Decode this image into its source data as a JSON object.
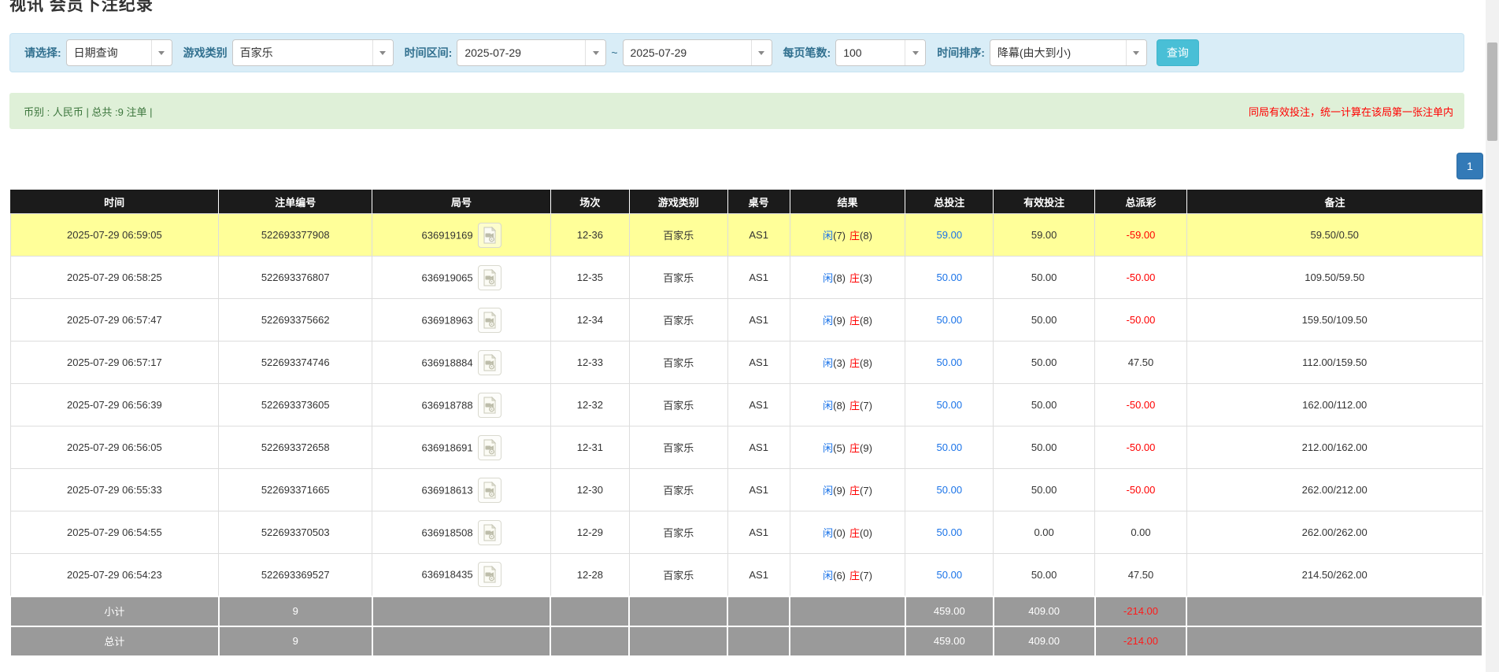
{
  "page": {
    "title": "视讯 会员下注纪录"
  },
  "filter": {
    "select_label": "请选择:",
    "select_value": "日期查询",
    "game_label": "游戏类别",
    "game_value": "百家乐",
    "range_label": "时间区间:",
    "date_from": "2025-07-29",
    "range_sep": "~",
    "date_to": "2025-07-29",
    "per_page_label": "每页笔数:",
    "per_page_value": "100",
    "sort_label": "时间排序:",
    "sort_value": "降幕(由大到小)",
    "search_button": "查询"
  },
  "summary": {
    "left_text": "币别 : 人民币 | 总共 :9 注单 |",
    "right_text": "同局有效投注，统一计算在该局第一张注单内"
  },
  "pagination": {
    "page": "1"
  },
  "icons": {
    "video_icon": "video-replay-icon",
    "dropdown_icon": "chevron-down-icon"
  },
  "colors": {
    "accent_blue": "#1a73e8",
    "negative_red": "#ff0000",
    "highlight_yellow": "#ffff99",
    "header_black": "#1b1b1b",
    "footer_gray": "#9a9a9a",
    "search_cyan": "#49bfd6",
    "pagination_blue": "#337ab7",
    "summary_green_bg": "#dff0d8",
    "filter_blue_bg": "#d9edf7"
  },
  "table": {
    "headers": [
      "时间",
      "注单编号",
      "局号",
      "场次",
      "游戏类别",
      "桌号",
      "结果",
      "总投注",
      "有效投注",
      "总派彩",
      "备注"
    ],
    "rows": [
      {
        "time": "2025-07-29 06:59:05",
        "bet_id": "522693377908",
        "round_id": "636919169",
        "session": "12-36",
        "game": "百家乐",
        "table_no": "AS1",
        "player": "闲",
        "player_pts": "(7)",
        "banker": "庄",
        "banker_pts": "(8)",
        "total_bet": "59.00",
        "valid_bet": "59.00",
        "payout": "-59.00",
        "remark": "59.50/0.50",
        "highlight": true
      },
      {
        "time": "2025-07-29 06:58:25",
        "bet_id": "522693376807",
        "round_id": "636919065",
        "session": "12-35",
        "game": "百家乐",
        "table_no": "AS1",
        "player": "闲",
        "player_pts": "(8)",
        "banker": "庄",
        "banker_pts": "(3)",
        "total_bet": "50.00",
        "valid_bet": "50.00",
        "payout": "-50.00",
        "remark": "109.50/59.50",
        "highlight": false
      },
      {
        "time": "2025-07-29 06:57:47",
        "bet_id": "522693375662",
        "round_id": "636918963",
        "session": "12-34",
        "game": "百家乐",
        "table_no": "AS1",
        "player": "闲",
        "player_pts": "(9)",
        "banker": "庄",
        "banker_pts": "(8)",
        "total_bet": "50.00",
        "valid_bet": "50.00",
        "payout": "-50.00",
        "remark": "159.50/109.50",
        "highlight": false
      },
      {
        "time": "2025-07-29 06:57:17",
        "bet_id": "522693374746",
        "round_id": "636918884",
        "session": "12-33",
        "game": "百家乐",
        "table_no": "AS1",
        "player": "闲",
        "player_pts": "(3)",
        "banker": "庄",
        "banker_pts": "(8)",
        "total_bet": "50.00",
        "valid_bet": "50.00",
        "payout": "47.50",
        "remark": "112.00/159.50",
        "highlight": false
      },
      {
        "time": "2025-07-29 06:56:39",
        "bet_id": "522693373605",
        "round_id": "636918788",
        "session": "12-32",
        "game": "百家乐",
        "table_no": "AS1",
        "player": "闲",
        "player_pts": "(8)",
        "banker": "庄",
        "banker_pts": "(7)",
        "total_bet": "50.00",
        "valid_bet": "50.00",
        "payout": "-50.00",
        "remark": "162.00/112.00",
        "highlight": false
      },
      {
        "time": "2025-07-29 06:56:05",
        "bet_id": "522693372658",
        "round_id": "636918691",
        "session": "12-31",
        "game": "百家乐",
        "table_no": "AS1",
        "player": "闲",
        "player_pts": "(5)",
        "banker": "庄",
        "banker_pts": "(9)",
        "total_bet": "50.00",
        "valid_bet": "50.00",
        "payout": "-50.00",
        "remark": "212.00/162.00",
        "highlight": false
      },
      {
        "time": "2025-07-29 06:55:33",
        "bet_id": "522693371665",
        "round_id": "636918613",
        "session": "12-30",
        "game": "百家乐",
        "table_no": "AS1",
        "player": "闲",
        "player_pts": "(9)",
        "banker": "庄",
        "banker_pts": "(7)",
        "total_bet": "50.00",
        "valid_bet": "50.00",
        "payout": "-50.00",
        "remark": "262.00/212.00",
        "highlight": false
      },
      {
        "time": "2025-07-29 06:54:55",
        "bet_id": "522693370503",
        "round_id": "636918508",
        "session": "12-29",
        "game": "百家乐",
        "table_no": "AS1",
        "player": "闲",
        "player_pts": "(0)",
        "banker": "庄",
        "banker_pts": "(0)",
        "total_bet": "50.00",
        "valid_bet": "0.00",
        "payout": "0.00",
        "remark": "262.00/262.00",
        "highlight": false
      },
      {
        "time": "2025-07-29 06:54:23",
        "bet_id": "522693369527",
        "round_id": "636918435",
        "session": "12-28",
        "game": "百家乐",
        "table_no": "AS1",
        "player": "闲",
        "player_pts": "(6)",
        "banker": "庄",
        "banker_pts": "(7)",
        "total_bet": "50.00",
        "valid_bet": "50.00",
        "payout": "47.50",
        "remark": "214.50/262.00",
        "highlight": false
      }
    ],
    "subtotal": {
      "label": "小计",
      "count": "9",
      "total_bet": "459.00",
      "valid_bet": "409.00",
      "payout": "-214.00"
    },
    "total": {
      "label": "总计",
      "count": "9",
      "total_bet": "459.00",
      "valid_bet": "409.00",
      "payout": "-214.00"
    }
  }
}
